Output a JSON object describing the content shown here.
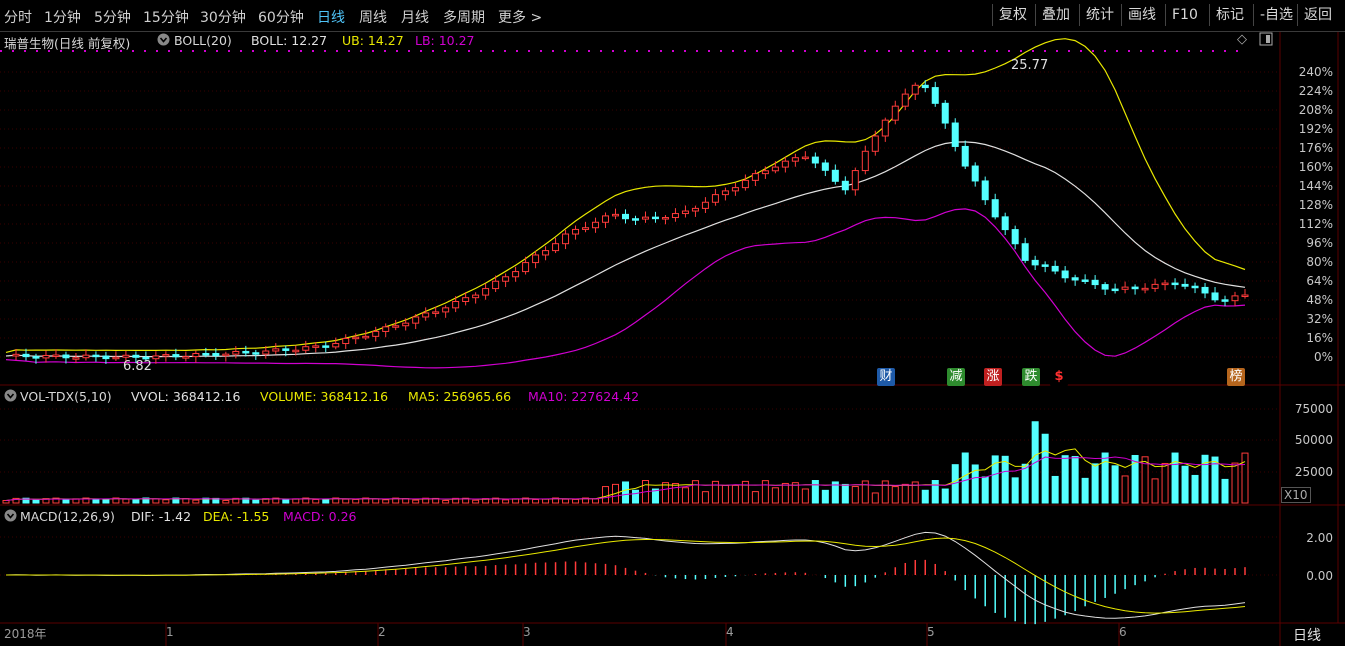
{
  "toolbar": {
    "periods": [
      "分时",
      "1分钟",
      "5分钟",
      "15分钟",
      "30分钟",
      "60分钟",
      "日线",
      "周线",
      "月线",
      "多周期",
      "更多 >"
    ],
    "active_index": 6,
    "tools": [
      "复权",
      "叠加",
      "统计",
      "画线",
      "F10",
      "标记",
      "-自选",
      "返回"
    ]
  },
  "main": {
    "stock_name": "瑞普生物(日线 前复权)",
    "indicator": "BOLL(20)",
    "boll": "BOLL: 12.27",
    "ub": "UB: 14.27",
    "lb": "LB: 10.27",
    "high_label": "25.77",
    "low_label": "6.82",
    "y_ticks": [
      "240%",
      "224%",
      "208%",
      "192%",
      "176%",
      "160%",
      "144%",
      "128%",
      "112%",
      "96%",
      "80%",
      "64%",
      "48%",
      "32%",
      "16%",
      "0%"
    ],
    "markers": [
      {
        "text": "财",
        "color": "#1e5aa8"
      },
      {
        "text": "减",
        "color": "#2e8b2e"
      },
      {
        "text": "涨",
        "color": "#c02020"
      },
      {
        "text": "跌",
        "color": "#2e8b2e"
      },
      {
        "text": "$",
        "color": "#000000"
      },
      {
        "text": "榜",
        "color": "#b5651d"
      }
    ]
  },
  "volume": {
    "indicator": "VOL-TDX(5,10)",
    "vvol": "VVOL: 368412.16",
    "volume": "VOLUME: 368412.16",
    "ma5": "MA5: 256965.66",
    "ma10": "MA10: 227624.42",
    "y_ticks": [
      "75000",
      "50000",
      "25000"
    ],
    "unit": "X10"
  },
  "macd": {
    "indicator": "MACD(12,26,9)",
    "dif": "DIF: -1.42",
    "dea": "DEA: -1.55",
    "macd": "MACD: 0.26",
    "y_ticks": [
      "2.00",
      "0.00"
    ]
  },
  "xaxis": {
    "labels": [
      "2018年",
      "1",
      "2",
      "3",
      "4",
      "5",
      "6"
    ],
    "period": "日线"
  },
  "colors": {
    "up": "#ff3b3b",
    "down": "#54ffff",
    "ub": "#e8e800",
    "mid": "#e0e0e0",
    "lb": "#d000d0",
    "active": "#4fc3f7"
  }
}
